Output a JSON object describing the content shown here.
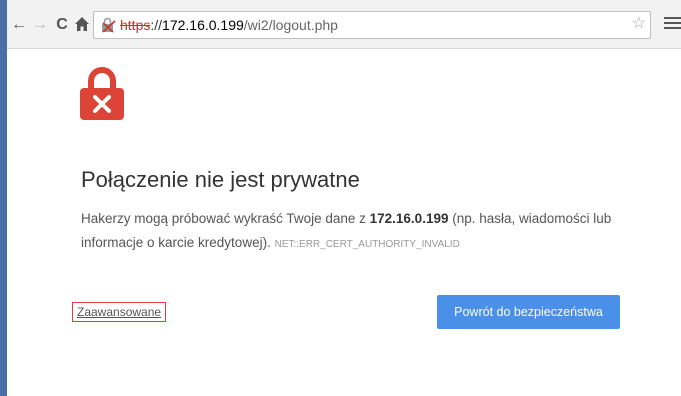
{
  "browser": {
    "url": {
      "scheme": "https",
      "separator": "://",
      "host": "172.16.0.199",
      "path": "/wi2/logout.php"
    },
    "icons": {
      "back": "arrow-left-icon",
      "forward": "arrow-right-icon",
      "reload": "reload-icon",
      "home": "home-icon",
      "security": "broken-lock-icon",
      "bookmark": "star-icon",
      "menu": "hamburger-menu-icon"
    }
  },
  "page": {
    "title": "Połączenie nie jest prywatne",
    "body": {
      "before_host": "Hakerzy mogą próbować wykraść Twoje dane z ",
      "host": "172.16.0.199",
      "after_host": " (np. hasła, wiadomości lub informacje o karcie kredytowej). ",
      "error_code": "NET::ERR_CERT_AUTHORITY_INVALID"
    },
    "advanced_link": "Zaawansowane",
    "back_button": "Powrót do bezpieczeństwa"
  },
  "colors": {
    "accent_button": "#4a8fe8",
    "warning_red": "#db4437",
    "highlight_border": "#e23b3b"
  }
}
